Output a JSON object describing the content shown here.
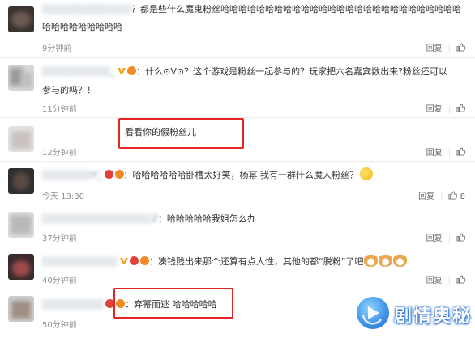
{
  "comments": [
    {
      "username": "░░░░░░░░░░░░░",
      "text_line1": "？都是些什么魔鬼粉丝哈哈哈哈哈哈哈哈哈哈哈哈哈哈哈哈哈哈哈哈哈哈哈哈哈哈哈",
      "text_line2": "哈哈哈哈哈哈哈哈哈",
      "time": "9分钟前",
      "reply": "回复",
      "like_count": ""
    },
    {
      "username": "░░░░░░░░░░_",
      "text_line1": "：什么⊙∀⊙？这个游戏是粉丝一起参与的？玩家把六名嘉宾数出来?粉丝还可以",
      "text_line2": "参与的吗？！",
      "time": "11分钟前",
      "reply": "回复",
      "like_count": ""
    },
    {
      "username": "",
      "text_line1": "看看你的假粉丝儿",
      "text_line2": "",
      "time": "12分钟前",
      "reply": "回复",
      "like_count": ""
    },
    {
      "username": "░░░░░░░iY_",
      "text_line1": "：哈哈哈哈哈哈卧槽太好笑，杨幂 我有一群什么魔人粉丝？",
      "text_line2": "",
      "time": "今天 13:30",
      "reply": "回复",
      "like_count": "8"
    },
    {
      "username": "░░░░░░░░░░░░░░░░Z",
      "text_line1": "：哈哈哈哈哈我姐怎么办",
      "text_line2": "",
      "time": "37分钟前",
      "reply": "回复",
      "like_count": ""
    },
    {
      "username": "░░░░░░░░░░░",
      "text_line1": "：凑钱贱出来那个还算有点人性，其他的都“脱粉”了吧",
      "text_line2": "",
      "time": "40分钟前",
      "reply": "回复",
      "like_count": ""
    },
    {
      "username": "░░░░░░░░░",
      "text_line1": "：弃幂而逃 哈哈哈哈哈",
      "text_line2": "",
      "time": "50分钟前",
      "reply": "",
      "like_count": ""
    }
  ],
  "watermark": {
    "text": "剧情奥秘"
  },
  "colors": {
    "highlight_box": "#e52424",
    "time": "#8f8f8f",
    "username": "#7a8ca0",
    "watermark_blue": "#2f75d2"
  }
}
